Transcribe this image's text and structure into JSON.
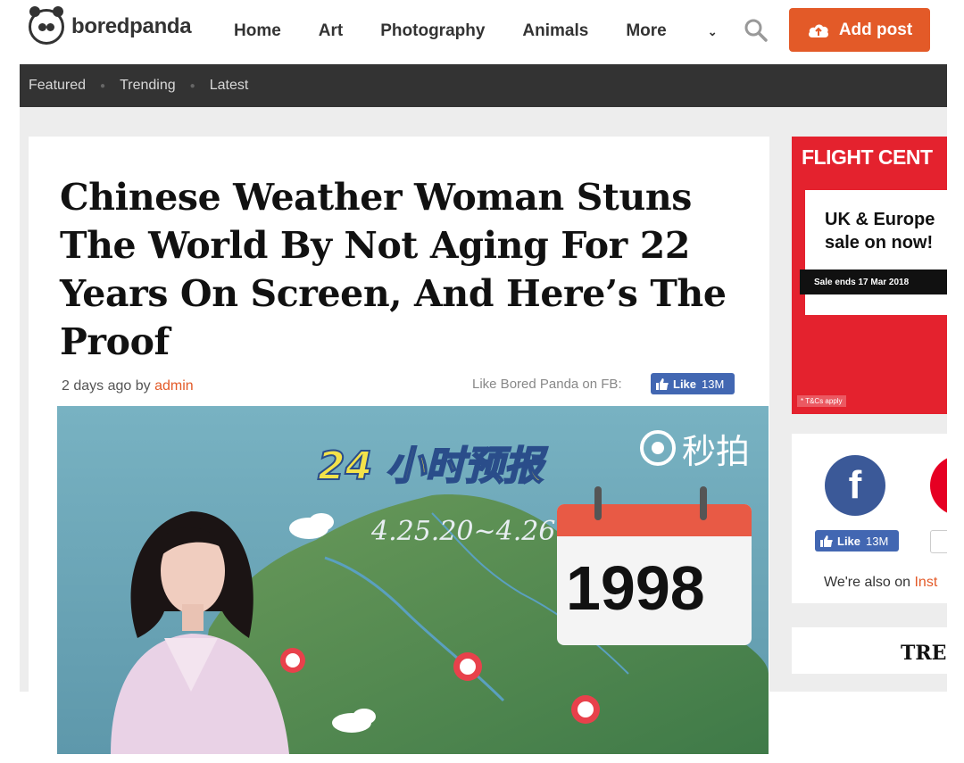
{
  "header": {
    "logo_text": "boredpanda",
    "nav": [
      "Home",
      "Art",
      "Photography",
      "Animals",
      "More"
    ],
    "add_post_label": "Add post"
  },
  "subnav": [
    "Featured",
    "Trending",
    "Latest"
  ],
  "article": {
    "title": "Chinese Weather Woman Stuns The World By Not Aging For 22 Years On Screen, And Here’s The Proof",
    "time_ago": "2 days ago by",
    "author": "admin",
    "fb_prompt": "Like Bored Panda on FB:",
    "fb_like": "Like",
    "fb_count": "13M"
  },
  "hero": {
    "banner": "24 小时预报",
    "dates": "4.25.20~4.26.2",
    "watermark": "秒拍",
    "year": "1998"
  },
  "ad": {
    "brand": "FLIGHT CENT",
    "headline": "UK & Europe sale on now!",
    "ribbon": "Sale ends 17 Mar 2018",
    "tc": "* T&Cs apply"
  },
  "social": {
    "fb_letter": "f",
    "like_label": "Like",
    "like_count": "13M",
    "also_on": "We're also on",
    "also_on_link": "Inst"
  },
  "sidebar": {
    "trending_label": "TREI"
  },
  "colors": {
    "accent": "#e35a28",
    "subnav_bg": "#333333",
    "facebook": "#3b5998",
    "ad_red": "#e4222e"
  }
}
